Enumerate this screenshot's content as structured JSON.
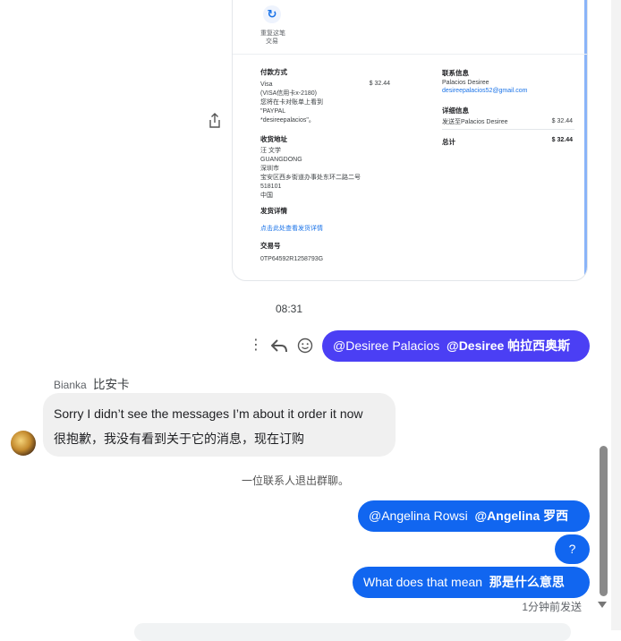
{
  "receipt": {
    "repeat_label_1": "重复这笔",
    "repeat_label_2": "交易",
    "payment": {
      "heading": "付款方式",
      "line1": "Visa",
      "line2": "(VISA信用卡x-2180)",
      "line3": "您将在卡对账单上看到",
      "line4": "\"PAYPAL",
      "line5": "*desireepalacios\"。",
      "amount": "$ 32.44"
    },
    "shipping": {
      "heading": "收货地址",
      "line1": "汪 文学",
      "line2": "GUANGDONG",
      "line3": "深圳市",
      "line4": "宝安区西乡街道办事处东环二路二号",
      "line5": "518101",
      "line6": "中国"
    },
    "invoice": {
      "heading": "发货详情",
      "link": "点击此处查看发货详情"
    },
    "transaction": {
      "heading": "交易号",
      "value": "0TP64592R1258793G"
    },
    "contact": {
      "heading": "联系信息",
      "name": "Palacios Desiree",
      "email": "desireepalacios52@gmail.com"
    },
    "details": {
      "heading": "详细信息",
      "item": "发送至Palacios Desiree",
      "item_amount": "$ 32.44",
      "total_label": "总计",
      "total_amount": "$ 32.44"
    }
  },
  "time_label": "08:31",
  "messages": {
    "out_mention_1": {
      "a": "@Desiree Palacios",
      "b": "@Desiree 帕拉西奥斯"
    },
    "sender_name": "Bianka",
    "sender_name_cn": "比安卡",
    "in_line1": "Sorry I didn’t see the messages I’m about it order it now",
    "in_line2": "很抱歉，我没有看到关于它的消息，现在订购",
    "system": "一位联系人退出群聊。",
    "out_mention_2": {
      "a": "@Angelina Rowsi",
      "b": "@Angelina 罗西"
    },
    "out_q": "?",
    "out_meaning": {
      "a": "What does that mean",
      "b": "那是什么意思"
    },
    "sent_status": "1分钟前发送"
  },
  "colors": {
    "accent_blue": "#1166f0",
    "accent_purple": "#4b3ff4",
    "link": "#1a73e8"
  }
}
